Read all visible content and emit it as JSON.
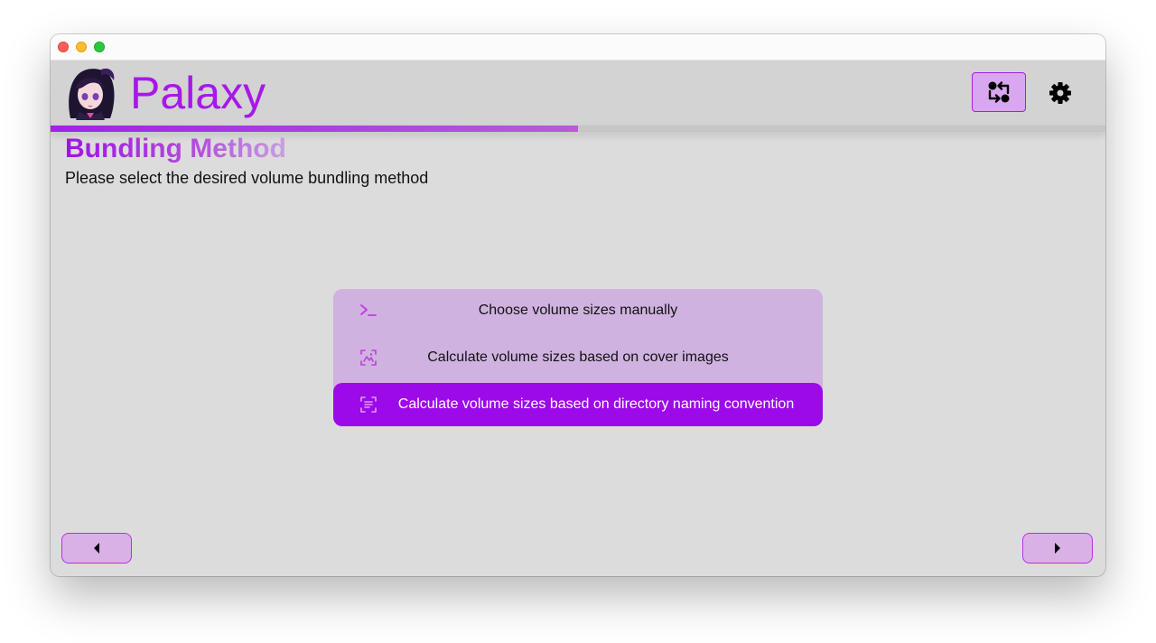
{
  "app": {
    "title": "Palaxy"
  },
  "header": {
    "switch_icon": "swap-arrows-icon",
    "settings_icon": "gear-icon"
  },
  "progress": {
    "value": 0.5
  },
  "step": {
    "title": "Bundling Method",
    "subtitle": "Please select the desired volume bundling method"
  },
  "options": [
    {
      "label": "Choose volume sizes manually",
      "icon": "terminal-icon",
      "selected": false
    },
    {
      "label": "Calculate volume sizes based on cover images",
      "icon": "image-scan-icon",
      "selected": false
    },
    {
      "label": "Calculate volume sizes based on directory naming convention",
      "icon": "text-scan-icon",
      "selected": true
    }
  ],
  "navigation": {
    "back_icon": "caret-left-icon",
    "next_icon": "caret-right-icon"
  },
  "colors": {
    "accent": "#a619e6",
    "selected_option": "#9c0ae9",
    "options_background": "#d0b2e0",
    "window_background": "#dcdcdc"
  }
}
